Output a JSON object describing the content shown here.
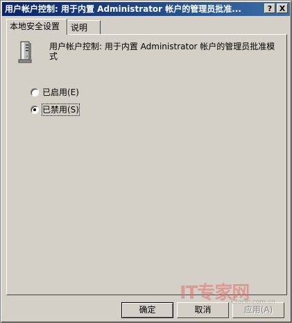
{
  "window": {
    "title": "用户帐户控制: 用于内置 Administrator 帐户的管理员批准...",
    "help_label": "?",
    "close_label": "X"
  },
  "tabs": [
    {
      "label": "本地安全设置",
      "active": true
    },
    {
      "label": "说明",
      "active": false
    }
  ],
  "policy": {
    "icon": "server-computer-icon",
    "title": "用户帐户控制: 用于内置 Administrator 帐户的管理员批准模式"
  },
  "options": [
    {
      "label": "已启用(E)",
      "selected": false
    },
    {
      "label": "已禁用(S)",
      "selected": true
    }
  ],
  "buttons": {
    "ok": "确定",
    "cancel": "取消",
    "apply": "应用(A)"
  },
  "watermark": {
    "text": "IT专家网",
    "sub": "Ctocio.com.cn"
  }
}
